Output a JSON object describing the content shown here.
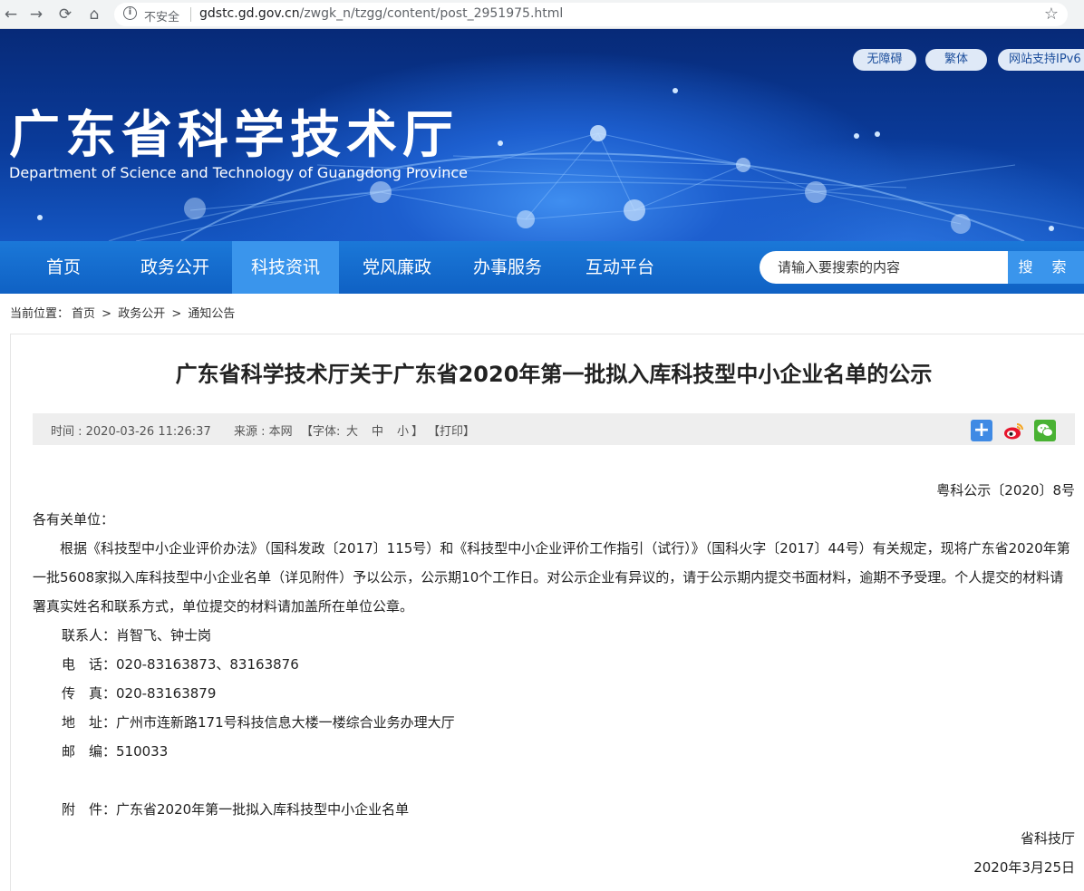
{
  "browser": {
    "insecure_label": "不安全",
    "url_host": "gdstc.gd.gov.cn",
    "url_path": "/zwgk_n/tzgg/content/post_2951975.html"
  },
  "header": {
    "title": "广东省科学技术厅",
    "subtitle": "Department of Science and Technology of Guangdong Province",
    "links": [
      "无障碍",
      "繁体",
      "网站支持IPv6"
    ]
  },
  "nav": {
    "items": [
      "首页",
      "政务公开",
      "科技资讯",
      "党风廉政",
      "办事服务",
      "互动平台"
    ],
    "active_index": 2,
    "search_placeholder": "请输入要搜索的内容",
    "search_button": "搜 索"
  },
  "breadcrumb": {
    "label": "当前位置：",
    "items": [
      "首页",
      ">",
      "政务公开",
      ">",
      "通知公告"
    ]
  },
  "article": {
    "title": "广东省科学技术厅关于广东省2020年第一批拟入库科技型中小企业名单的公示",
    "meta": {
      "time": "时间 : 2020-03-26 11:26:37",
      "source": "来源 : 本网",
      "font_label": "【字体:",
      "font_sizes": [
        "大",
        "中",
        "小"
      ],
      "font_end": "】",
      "print": "【打印】"
    },
    "doc_number": "粤科公示〔2020〕8号",
    "salutation": "各有关单位：",
    "paragraph": "根据《科技型中小企业评价办法》（国科发政〔2017〕115号）和《科技型中小企业评价工作指引（试行）》（国科火字〔2017〕44号）有关规定，现将广东省2020年第一批5608家拟入库科技型中小企业名单（详见附件）予以公示，公示期10个工作日。对公示企业有异议的，请于公示期内提交书面材料，逾期不予受理。个人提交的材料请署真实姓名和联系方式，单位提交的材料请加盖所在单位公章。",
    "contacts": [
      "联系人：肖智飞、钟士岗",
      "电　话：020-83163873、83163876",
      "传　真：020-83163879",
      "地　址：广州市连新路171号科技信息大楼一楼综合业务办理大厅",
      "邮　编：510033"
    ],
    "attachment": "附　件：广东省2020年第一批拟入库科技型中小企业名单",
    "signature": "省科技厅",
    "date": "2020年3月25日"
  },
  "colors": {
    "nav_bg": "#1b78d8",
    "nav_active": "#3a95ec",
    "banner": "#0a3b9a"
  }
}
